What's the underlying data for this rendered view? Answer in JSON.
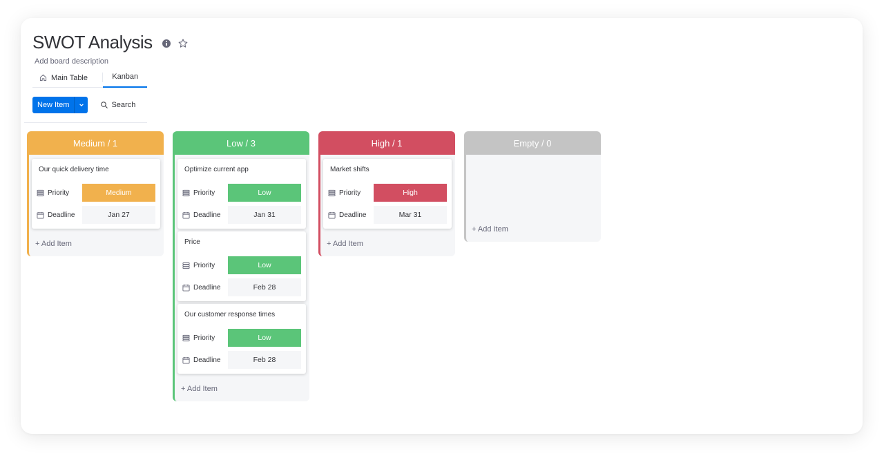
{
  "board": {
    "title": "SWOT Analysis",
    "description": "Add board description",
    "icons": {
      "info": "info-icon",
      "favorite": "star-icon"
    }
  },
  "tabs": [
    {
      "label": "Main Table",
      "icon": "home-icon",
      "active": false
    },
    {
      "label": "Kanban",
      "active": true
    }
  ],
  "toolbar": {
    "new_item_label": "New Item",
    "search_label": "Search"
  },
  "colors": {
    "medium": "#f1b14d",
    "low": "#5bc579",
    "high": "#d24e61",
    "empty": "#c4c4c4",
    "accent": "#0073ea"
  },
  "columns": [
    {
      "header": "Medium / 1",
      "items": [
        {
          "name": "Our quick delivery time",
          "priority_label": "Priority",
          "priority": "Medium",
          "deadline_label": "Deadline",
          "deadline": "Jan 27"
        }
      ],
      "add_label": "+ Add Item"
    },
    {
      "header": "Low / 3",
      "items": [
        {
          "name": "Optimize current app",
          "priority_label": "Priority",
          "priority": "Low",
          "deadline_label": "Deadline",
          "deadline": "Jan 31"
        },
        {
          "name": "Price",
          "priority_label": "Priority",
          "priority": "Low",
          "deadline_label": "Deadline",
          "deadline": "Feb 28"
        },
        {
          "name": "Our customer response times",
          "priority_label": "Priority",
          "priority": "Low",
          "deadline_label": "Deadline",
          "deadline": "Feb 28"
        }
      ],
      "add_label": "+ Add Item"
    },
    {
      "header": "High / 1",
      "items": [
        {
          "name": "Market shifts",
          "priority_label": "Priority",
          "priority": "High",
          "deadline_label": "Deadline",
          "deadline": "Mar 31"
        }
      ],
      "add_label": "+ Add Item"
    },
    {
      "header": "Empty / 0",
      "items": [],
      "add_label": "+ Add Item"
    }
  ]
}
